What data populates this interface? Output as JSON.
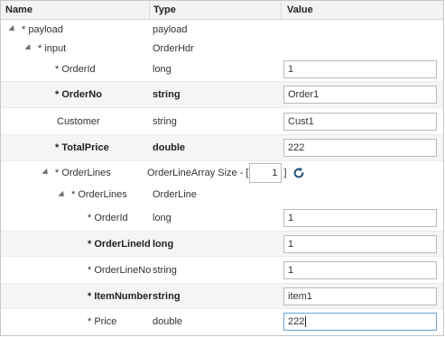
{
  "columns": {
    "name": "Name",
    "type": "Type",
    "value": "Value"
  },
  "rows": {
    "payload": {
      "name": "* payload",
      "type": "payload"
    },
    "input": {
      "name": "* input",
      "type": "OrderHdr"
    },
    "order_id": {
      "name": "* OrderId",
      "type": "long",
      "value": "1"
    },
    "order_no": {
      "name": "* OrderNo",
      "type": "string",
      "value": "Order1"
    },
    "customer": {
      "name": "Customer",
      "type": "string",
      "value": "Cust1"
    },
    "total_price": {
      "name": "* TotalPrice",
      "type": "double",
      "value": "222"
    },
    "order_lines_array": {
      "name": "* OrderLines",
      "type_prefix": "OrderLineArray Size - [",
      "size": "1",
      "type_suffix": "]"
    },
    "order_lines": {
      "name": "* OrderLines",
      "type": "OrderLine"
    },
    "line_order_id": {
      "name": "* OrderId",
      "type": "long",
      "value": "1"
    },
    "order_line_id": {
      "name": "* OrderLineId",
      "type": "long",
      "value": "1"
    },
    "order_line_no": {
      "name": "* OrderLineNo",
      "type": "string",
      "value": "1"
    },
    "item_number": {
      "name": "* ItemNumber",
      "type": "string",
      "value": "item1"
    },
    "price": {
      "name": "* Price",
      "type": "double",
      "value": "222"
    }
  },
  "icons": {
    "expand": "expanded-triangle-icon",
    "refresh": "refresh-icon"
  },
  "colors": {
    "header_bg": "#f3f3f3",
    "row_shade": "#f5f5f5",
    "focus_border": "#6aa3d5",
    "refresh_icon": "#1f4e79"
  }
}
